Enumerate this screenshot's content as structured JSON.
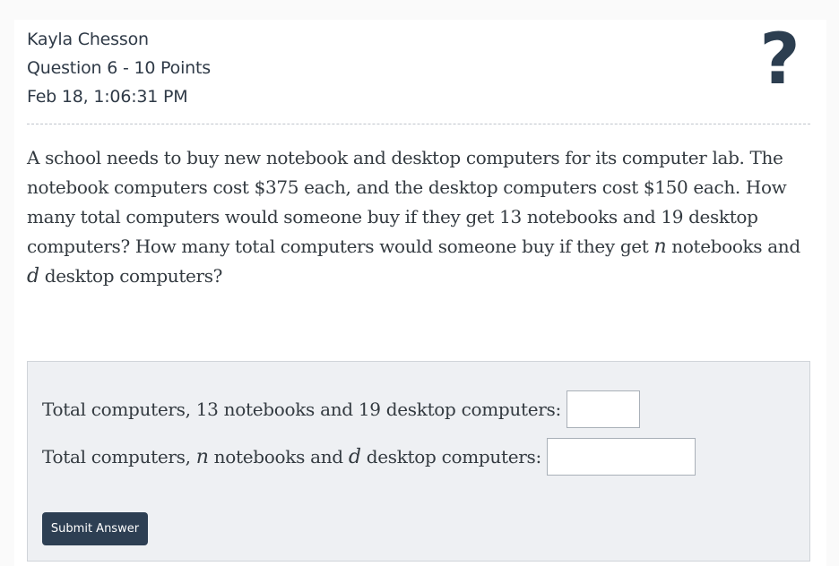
{
  "header": {
    "student_name": "Kayla Chesson",
    "question_info": "Question 6 - 10 Points",
    "timestamp": "Feb 18, 1:06:31 PM",
    "help_symbol": "?"
  },
  "question": {
    "text_before_n": "A school needs to buy new notebook and desktop computers for its computer lab. The notebook computers cost $375 each, and the desktop computers cost $150 each. How many total computers would someone buy if they get 13 notebooks and 19 desktop computers? How many total computers would someone buy if they get ",
    "var_n": "n",
    "text_between": " notebooks and ",
    "var_d": "d",
    "text_after_d": " desktop computers?"
  },
  "answers": {
    "row1_label": "Total computers, 13 notebooks and 19 desktop computers:",
    "row1_value": "",
    "row2_label_start": "Total computers, ",
    "row2_var_n": "n",
    "row2_label_mid": " notebooks and ",
    "row2_var_d": "d",
    "row2_label_end": " desktop computers:",
    "row2_value": ""
  },
  "submit": {
    "label": "Submit Answer"
  }
}
